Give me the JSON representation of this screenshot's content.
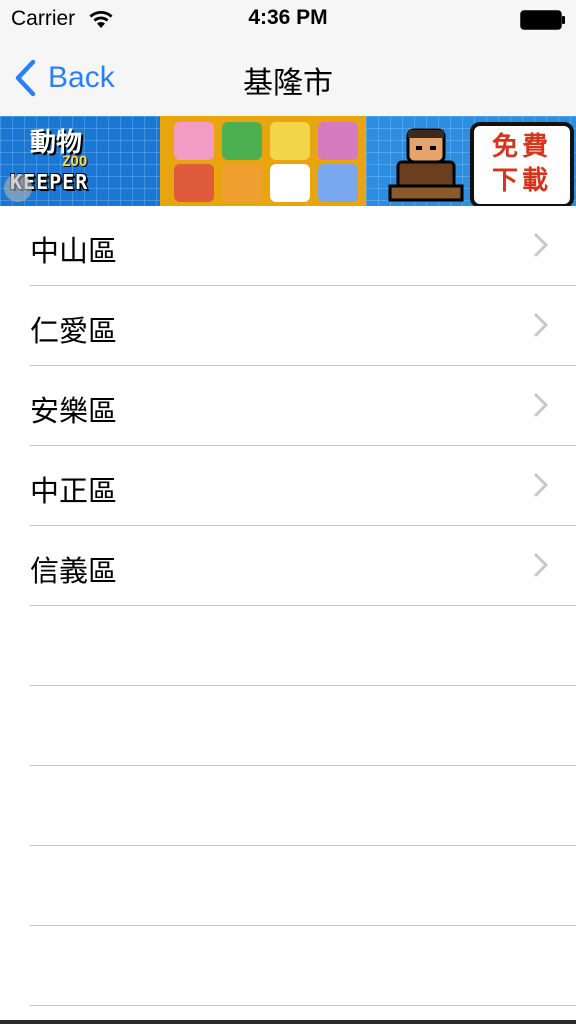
{
  "status_bar": {
    "carrier": "Carrier",
    "time": "4:36 PM",
    "wifi_icon": "wifi-icon",
    "battery_icon": "battery-icon"
  },
  "nav": {
    "back_label": "Back",
    "title": "基隆市",
    "accent_color": "#2a7ffc"
  },
  "banner": {
    "game_name_top": "動物",
    "game_name_small": "ZOO",
    "game_name": "KEEPER",
    "cta": "免費下載"
  },
  "list": {
    "items": [
      {
        "label": "中山區"
      },
      {
        "label": "仁愛區"
      },
      {
        "label": "安樂區"
      },
      {
        "label": "中正區"
      },
      {
        "label": "信義區"
      }
    ]
  }
}
